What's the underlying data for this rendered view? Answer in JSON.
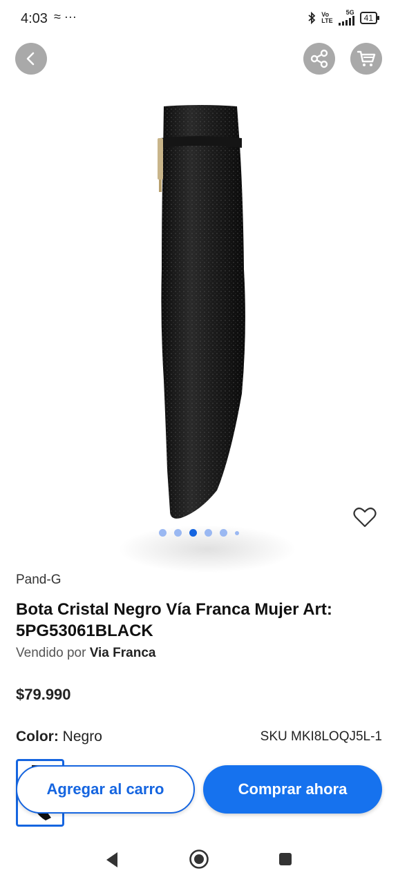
{
  "status_bar": {
    "time": "4:03",
    "left_icons": "≈ ···",
    "network_top": "Vo",
    "network_bottom": "LTE",
    "net_type": "5G",
    "battery": "41"
  },
  "header": {
    "back_icon": "chevron-left-icon",
    "share_icon": "share-icon",
    "cart_icon": "cart-icon"
  },
  "gallery": {
    "image_count": 6,
    "active_index": 2,
    "favorite_icon": "heart-outline-icon"
  },
  "product": {
    "brand": "Pand-G",
    "title": "Bota Cristal Negro Vía Franca Mujer Art: 5PG53061BLACK",
    "sold_by_prefix": "Vendido por",
    "seller": "Via Franca",
    "price": "$79.990",
    "color_label": "Color:",
    "color_value": "Negro",
    "sku": "SKU MKI8LOQJ5L-1"
  },
  "actions": {
    "add_to_cart": "Agregar al carro",
    "buy_now": "Comprar ahora"
  },
  "colors": {
    "accent": "#1565e0",
    "button_solid": "#1672ee",
    "header_button_bg": "#a9a9a9"
  }
}
